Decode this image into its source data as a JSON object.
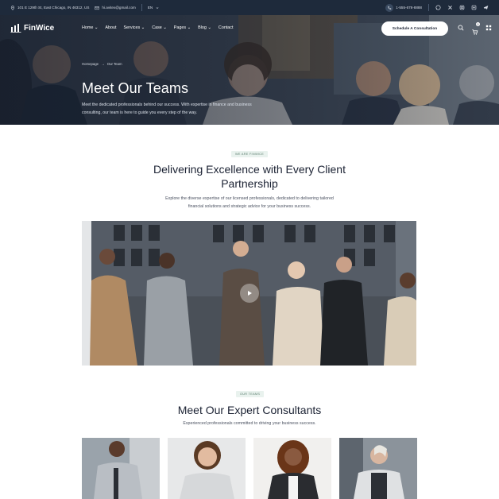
{
  "topbar": {
    "address": "101 E 129th St, East Chicago, IN 46312, US",
    "email": "hi.avitex@gmail.com",
    "lang": "EN",
    "phone": "1-555-678-8888",
    "social_icons": [
      "whatsapp-icon",
      "x-icon",
      "instagram-icon",
      "pinterest-icon",
      "telegram-icon"
    ]
  },
  "nav": {
    "logo": "FinWice",
    "items": [
      {
        "label": "Home",
        "dropdown": true
      },
      {
        "label": "About",
        "dropdown": false
      },
      {
        "label": "Services",
        "dropdown": true
      },
      {
        "label": "Case",
        "dropdown": true
      },
      {
        "label": "Pages",
        "dropdown": true
      },
      {
        "label": "Blog",
        "dropdown": true
      },
      {
        "label": "Contact",
        "dropdown": false
      }
    ],
    "cta": "Schedule A Consultation",
    "cart_count": "0"
  },
  "hero": {
    "breadcrumb_home": "Homepage",
    "breadcrumb_sep": "→",
    "breadcrumb_current": "Our Team",
    "title": "Meet Our Teams",
    "desc": "Meet the dedicated professionals behind our success. With expertise in finance and business consulting, our team is here to guide you every step of the way."
  },
  "intro": {
    "tag": "WE ARE FINWICE",
    "title_line1": "Delivering Excellence with Every Client",
    "title_line2": "Partnership",
    "desc_line1": "Explore the diverse expertise of our licensed professionals, dedicated to delivering tailored",
    "desc_line2": "financial solutions and strategic advice for your business success."
  },
  "team": {
    "tag": "OUR TEAMS",
    "title": "Meet Our Expert Consultants",
    "desc": "Experienced professionals committed to driving your business success."
  },
  "colors": {
    "topbar_bg": "#1e2a3b",
    "tag_bg": "#e9f2ee",
    "tag_text": "#5c7d6e",
    "heading": "#1b2233"
  }
}
